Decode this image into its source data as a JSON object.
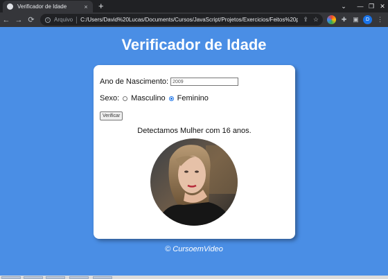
{
  "browser": {
    "tab_title": "Verificador de Idade",
    "tab_close": "×",
    "new_tab": "+",
    "window_controls": [
      "⌄",
      "—",
      "❐",
      "✕"
    ],
    "nav": {
      "back": "←",
      "forward": "→",
      "reload": "⟳"
    },
    "scheme_label": "Arquivo",
    "url": "C:/Users/David%20Lucas/Documents/Cursos/JavaScript/Projetos/Exercicios/Feitos%20por%...",
    "menu": "⋮",
    "profile_initial": "D"
  },
  "page": {
    "title": "Verificador de Idade",
    "birth_year_label": "Ano de Nascimento:",
    "birth_year_value": "2009",
    "sex_label": "Sexo:",
    "sex_options": [
      {
        "label": "Masculino",
        "checked": false
      },
      {
        "label": "Feminino",
        "checked": true
      }
    ],
    "verify_button": "Verificar",
    "result_text": "Detectamos Mulher com 16 anos.",
    "photo_icon": "woman-photo",
    "footer": "© CursoemVideo"
  }
}
